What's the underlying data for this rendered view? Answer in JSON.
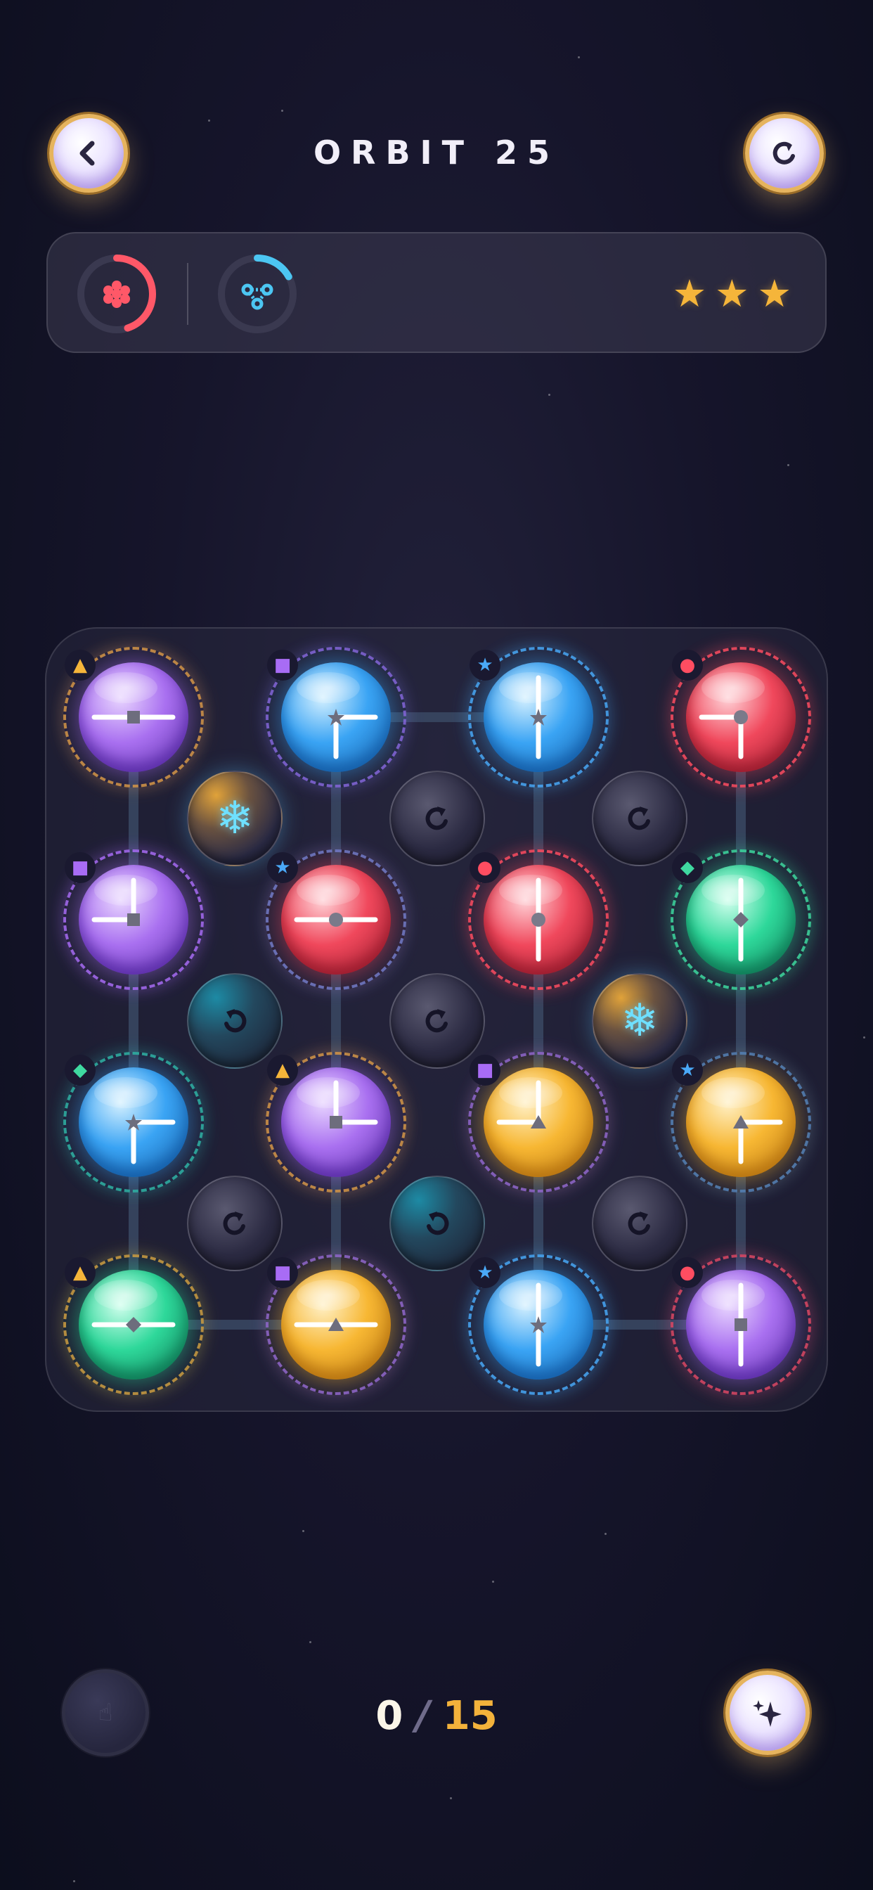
{
  "header": {
    "title": "ORBIT 25",
    "back_icon": "chevron-left-icon",
    "restart_icon": "restart-icon"
  },
  "goals": {
    "items": [
      {
        "icon": "red-cluster-icon",
        "color": "#ff5868",
        "progress": 0.45
      },
      {
        "icon": "cyan-network-icon",
        "color": "#4cc6f2",
        "progress": 0.17
      }
    ],
    "stars_earned": 3,
    "stars": [
      "★",
      "★",
      "★"
    ]
  },
  "board": {
    "orbs": [
      {
        "row": 0,
        "col": 0,
        "color": "purple",
        "core": "square",
        "hands": [
          "left",
          "right"
        ],
        "badge": "▲",
        "badge_color": "#f5b53a",
        "ring": "#d99a3c"
      },
      {
        "row": 0,
        "col": 1,
        "color": "blue",
        "core": "star",
        "hands": [
          "down",
          "right"
        ],
        "badge": "■",
        "badge_color": "#a86cf5",
        "ring": "#8a62d8"
      },
      {
        "row": 0,
        "col": 2,
        "color": "blue",
        "core": "star",
        "hands": [
          "up",
          "down"
        ],
        "badge": "★",
        "badge_color": "#4aa9f7",
        "ring": "#4aa9f7"
      },
      {
        "row": 0,
        "col": 3,
        "color": "red",
        "core": "circle",
        "hands": [
          "left",
          "down"
        ],
        "badge": "●",
        "badge_color": "#ff4d61",
        "ring": "#ff4d61"
      },
      {
        "row": 1,
        "col": 0,
        "color": "purple",
        "core": "square",
        "hands": [
          "up",
          "left"
        ],
        "badge": "■",
        "badge_color": "#a86cf5",
        "ring": "#a86cf5"
      },
      {
        "row": 1,
        "col": 1,
        "color": "red",
        "core": "circle",
        "hands": [
          "left",
          "right"
        ],
        "badge": "★",
        "badge_color": "#4aa9f7",
        "ring": "#6a7fd0"
      },
      {
        "row": 1,
        "col": 2,
        "color": "red",
        "core": "circle",
        "hands": [
          "up",
          "down"
        ],
        "badge": "●",
        "badge_color": "#ff4d61",
        "ring": "#ff4d61"
      },
      {
        "row": 1,
        "col": 3,
        "color": "green",
        "core": "diamond",
        "hands": [
          "up",
          "down"
        ],
        "badge": "◆",
        "badge_color": "#3fd9a0",
        "ring": "#3fd9a0"
      },
      {
        "row": 2,
        "col": 0,
        "color": "blue",
        "core": "star",
        "hands": [
          "down",
          "right"
        ],
        "badge": "◆",
        "badge_color": "#3fd9a0",
        "ring": "#2fb5a0"
      },
      {
        "row": 2,
        "col": 1,
        "color": "purple",
        "core": "square",
        "hands": [
          "up",
          "right"
        ],
        "badge": "▲",
        "badge_color": "#f5b53a",
        "ring": "#d99a3c"
      },
      {
        "row": 2,
        "col": 2,
        "color": "yellow",
        "core": "triangle",
        "hands": [
          "up",
          "left"
        ],
        "badge": "■",
        "badge_color": "#a86cf5",
        "ring": "#8a62d8"
      },
      {
        "row": 2,
        "col": 3,
        "color": "yellow",
        "core": "triangle",
        "hands": [
          "down",
          "right"
        ],
        "badge": "★",
        "badge_color": "#4aa9f7",
        "ring": "#4a7fc0"
      },
      {
        "row": 3,
        "col": 0,
        "color": "green",
        "core": "diamond",
        "hands": [
          "left",
          "right"
        ],
        "badge": "▲",
        "badge_color": "#f5b53a",
        "ring": "#d99a3c"
      },
      {
        "row": 3,
        "col": 1,
        "color": "yellow",
        "core": "triangle",
        "hands": [
          "left",
          "right"
        ],
        "badge": "■",
        "badge_color": "#a86cf5",
        "ring": "#8a62d8"
      },
      {
        "row": 3,
        "col": 2,
        "color": "blue",
        "core": "star",
        "hands": [
          "up",
          "down"
        ],
        "badge": "★",
        "badge_color": "#4aa9f7",
        "ring": "#4aa9f7"
      },
      {
        "row": 3,
        "col": 3,
        "color": "purple",
        "core": "square",
        "hands": [
          "up",
          "down"
        ],
        "badge": "●",
        "badge_color": "#ff4d61",
        "ring": "#e0455a"
      }
    ],
    "nodes": [
      {
        "row": 0,
        "col": 0,
        "type": "frozen",
        "glyph": "❄"
      },
      {
        "row": 0,
        "col": 1,
        "type": "rotate-cw"
      },
      {
        "row": 0,
        "col": 2,
        "type": "rotate-cw"
      },
      {
        "row": 1,
        "col": 0,
        "type": "rotate-ccw"
      },
      {
        "row": 1,
        "col": 1,
        "type": "rotate-cw"
      },
      {
        "row": 1,
        "col": 2,
        "type": "frozen",
        "glyph": "❄"
      },
      {
        "row": 2,
        "col": 0,
        "type": "rotate-cw"
      },
      {
        "row": 2,
        "col": 1,
        "type": "rotate-ccw"
      },
      {
        "row": 2,
        "col": 2,
        "type": "rotate-cw"
      }
    ],
    "links": [
      {
        "from": [
          0,
          0
        ],
        "to": [
          1,
          0
        ]
      },
      {
        "from": [
          0,
          1
        ],
        "to": [
          0,
          2
        ]
      },
      {
        "from": [
          0,
          1
        ],
        "to": [
          1,
          1
        ]
      },
      {
        "from": [
          0,
          2
        ],
        "to": [
          1,
          2
        ]
      },
      {
        "from": [
          0,
          3
        ],
        "to": [
          1,
          3
        ]
      },
      {
        "from": [
          1,
          0
        ],
        "to": [
          2,
          0
        ]
      },
      {
        "from": [
          1,
          1
        ],
        "to": [
          2,
          1
        ]
      },
      {
        "from": [
          1,
          2
        ],
        "to": [
          2,
          2
        ]
      },
      {
        "from": [
          1,
          3
        ],
        "to": [
          2,
          3
        ]
      },
      {
        "from": [
          2,
          0
        ],
        "to": [
          3,
          0
        ]
      },
      {
        "from": [
          2,
          1
        ],
        "to": [
          3,
          1
        ]
      },
      {
        "from": [
          2,
          2
        ],
        "to": [
          3,
          2
        ]
      },
      {
        "from": [
          2,
          3
        ],
        "to": [
          3,
          3
        ]
      },
      {
        "from": [
          3,
          0
        ],
        "to": [
          3,
          1
        ]
      },
      {
        "from": [
          3,
          2
        ],
        "to": [
          3,
          3
        ]
      }
    ]
  },
  "footer": {
    "moves_current": "0",
    "moves_separator": "/",
    "moves_max": "15",
    "hint_icon": "hint-icon",
    "magic_icon": "sparkle-icon"
  },
  "colors": {
    "purple": [
      "#e9d6ff",
      "#a970f0",
      "#5b2ea8"
    ],
    "blue": [
      "#d6f1ff",
      "#3aa4f4",
      "#155ea8"
    ],
    "red": [
      "#ffd3d8",
      "#f0485c",
      "#9a1c2e"
    ],
    "green": [
      "#d2ffee",
      "#2ed89a",
      "#0f7a56"
    ],
    "yellow": [
      "#fff1c8",
      "#f7b733",
      "#b77411"
    ]
  }
}
